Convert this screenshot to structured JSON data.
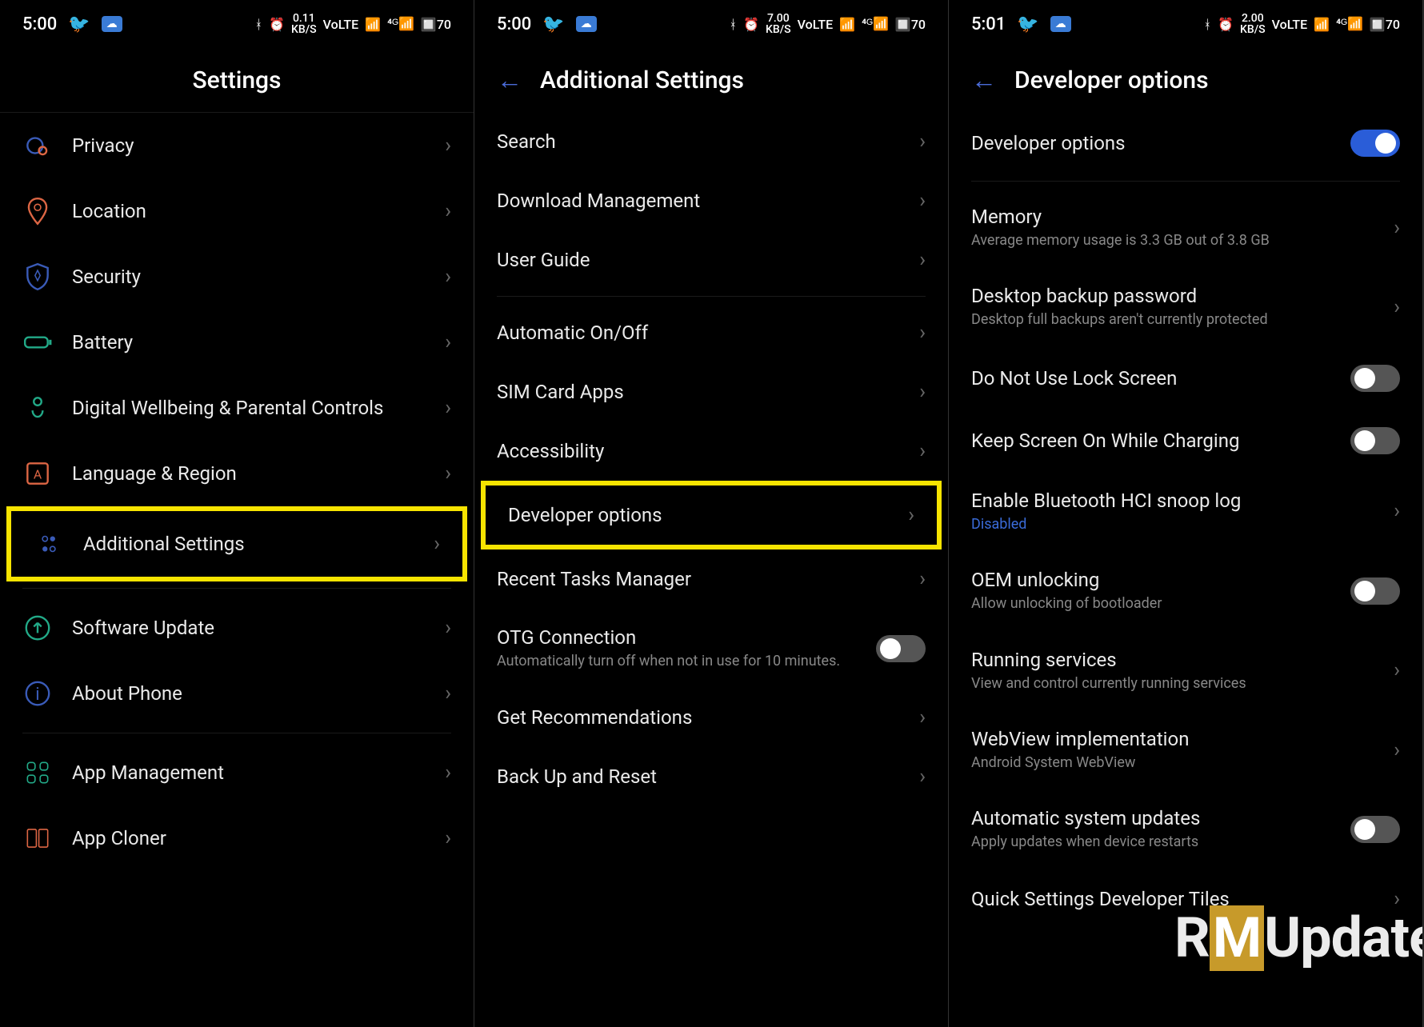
{
  "screens": [
    {
      "status": {
        "time": "5:00",
        "speed": "0.11",
        "speed_unit": "KB/S",
        "battery": "70"
      },
      "title": "Settings",
      "items": [
        {
          "icon": "privacy",
          "label": "Privacy"
        },
        {
          "icon": "location",
          "label": "Location"
        },
        {
          "icon": "security",
          "label": "Security"
        },
        {
          "icon": "battery",
          "label": "Battery"
        },
        {
          "icon": "wellbeing",
          "label": "Digital Wellbeing & Parental Controls"
        },
        {
          "icon": "language",
          "label": "Language & Region"
        },
        {
          "icon": "additional",
          "label": "Additional Settings",
          "highlight": true
        },
        {
          "icon": "update",
          "label": "Software Update"
        },
        {
          "icon": "about",
          "label": "About Phone"
        },
        {
          "icon": "apps",
          "label": "App Management"
        },
        {
          "icon": "cloner",
          "label": "App Cloner"
        }
      ]
    },
    {
      "status": {
        "time": "5:00",
        "speed": "7.00",
        "speed_unit": "KB/S",
        "battery": "70"
      },
      "title": "Additional Settings",
      "items": [
        {
          "label": "Search"
        },
        {
          "label": "Download Management"
        },
        {
          "label": "User Guide"
        },
        {
          "label": "Automatic On/Off"
        },
        {
          "label": "SIM Card Apps"
        },
        {
          "label": "Accessibility"
        },
        {
          "label": "Developer options",
          "highlight": true
        },
        {
          "label": "Recent Tasks Manager"
        },
        {
          "label": "OTG Connection",
          "sub": "Automatically turn off when not in use for 10 minutes.",
          "toggle": false
        },
        {
          "label": "Get Recommendations"
        },
        {
          "label": "Back Up and Reset"
        }
      ]
    },
    {
      "status": {
        "time": "5:01",
        "speed": "2.00",
        "speed_unit": "KB/S",
        "battery": "70"
      },
      "title": "Developer options",
      "items": [
        {
          "label": "Developer options",
          "toggle": true,
          "toggleOn": true
        },
        {
          "label": "Memory",
          "sub": "Average memory usage is 3.3 GB out of 3.8 GB"
        },
        {
          "label": "Desktop backup password",
          "sub": "Desktop full backups aren't currently protected"
        },
        {
          "label": "Do Not Use Lock Screen",
          "toggle": true
        },
        {
          "label": "Keep Screen On While Charging",
          "toggle": true
        },
        {
          "label": "Enable Bluetooth HCI snoop log",
          "sub": "Disabled",
          "subBlue": true
        },
        {
          "label": "OEM unlocking",
          "sub": "Allow unlocking of bootloader",
          "toggle": true
        },
        {
          "label": "Running services",
          "sub": "View and control currently running services"
        },
        {
          "label": "WebView implementation",
          "sub": "Android System WebView"
        },
        {
          "label": "Automatic system updates",
          "sub": "Apply updates when device restarts",
          "toggle": true
        },
        {
          "label": "Quick Settings Developer Tiles"
        }
      ]
    }
  ],
  "watermark_prefix": "R",
  "watermark_mid": "M",
  "watermark_suffix": "Update"
}
